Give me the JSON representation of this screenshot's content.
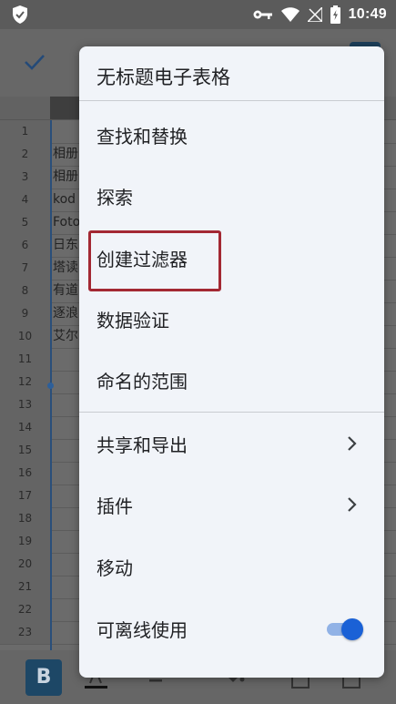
{
  "status_bar": {
    "time": "10:49",
    "icons": [
      "shield-icon",
      "key-icon",
      "wifi-icon",
      "no-signal-icon",
      "battery-charging-icon"
    ]
  },
  "sheet": {
    "rows": [
      {
        "num": "1",
        "cell": ""
      },
      {
        "num": "2",
        "cell": "相册"
      },
      {
        "num": "3",
        "cell": "相册"
      },
      {
        "num": "4",
        "cell": "kod"
      },
      {
        "num": "5",
        "cell": "Foto"
      },
      {
        "num": "6",
        "cell": "日东"
      },
      {
        "num": "7",
        "cell": "塔读"
      },
      {
        "num": "8",
        "cell": "有道"
      },
      {
        "num": "9",
        "cell": "逐浪"
      },
      {
        "num": "10",
        "cell": "艾尔"
      },
      {
        "num": "11",
        "cell": ""
      },
      {
        "num": "12",
        "cell": ""
      },
      {
        "num": "13",
        "cell": ""
      },
      {
        "num": "14",
        "cell": ""
      },
      {
        "num": "15",
        "cell": ""
      },
      {
        "num": "16",
        "cell": ""
      },
      {
        "num": "17",
        "cell": ""
      },
      {
        "num": "18",
        "cell": ""
      },
      {
        "num": "19",
        "cell": ""
      },
      {
        "num": "20",
        "cell": ""
      },
      {
        "num": "21",
        "cell": ""
      },
      {
        "num": "22",
        "cell": ""
      },
      {
        "num": "23",
        "cell": ""
      }
    ]
  },
  "toolbar": {
    "bold_label": "B"
  },
  "menu": {
    "title": "无标题电子表格",
    "items": [
      {
        "label": "查找和替换"
      },
      {
        "label": "探索"
      },
      {
        "label": "创建过滤器"
      },
      {
        "label": "数据验证"
      },
      {
        "label": "命名的范围"
      },
      {
        "label": "共享和导出"
      },
      {
        "label": "插件"
      },
      {
        "label": "移动"
      },
      {
        "label": "可离线使用"
      }
    ],
    "offline_enabled": true
  },
  "colors": {
    "accent": "#1a61d6",
    "highlight_border": "#a32833",
    "menu_bg": "#f1f4f9"
  }
}
